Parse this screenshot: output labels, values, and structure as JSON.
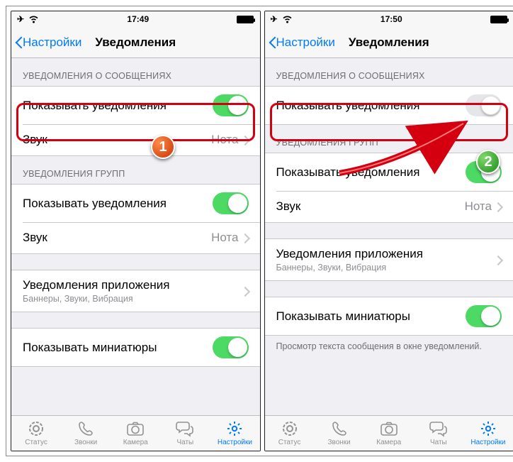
{
  "statusbar": {
    "time_left": "17:49",
    "time_right": "17:50"
  },
  "nav": {
    "back": "Настройки",
    "title": "Уведомления"
  },
  "sections": {
    "msg_header": "УВЕДОМЛЕНИЯ О СООБЩЕНИЯХ",
    "group_header": "УВЕДОМЛЕНИЯ ГРУПП",
    "show_notifications": "Показывать уведомления",
    "sound": "Звук",
    "sound_value": "Нота",
    "app_notif_title": "Уведомления приложения",
    "app_notif_sub": "Баннеры, Звуки, Вибрация",
    "show_thumbs": "Показывать миниатюры",
    "footer_text": "Просмотр текста сообщения в окне уведомлений."
  },
  "tabs": {
    "status": "Статус",
    "calls": "Звонки",
    "camera": "Камера",
    "chats": "Чаты",
    "settings": "Настройки"
  },
  "badge1": "1",
  "badge2": "2"
}
